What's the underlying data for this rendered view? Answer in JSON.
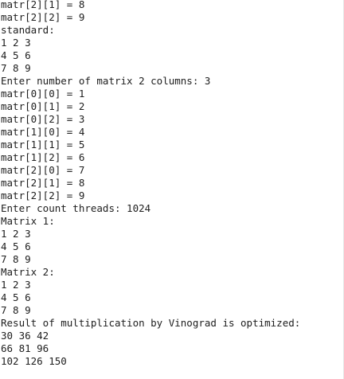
{
  "console": {
    "lines": [
      "matr[2][1] = 8",
      "matr[2][2] = 9",
      "standard:",
      "1 2 3",
      "4 5 6",
      "7 8 9",
      "Enter number of matrix 2 columns: 3",
      "matr[0][0] = 1",
      "matr[0][1] = 2",
      "matr[0][2] = 3",
      "matr[1][0] = 4",
      "matr[1][1] = 5",
      "matr[1][2] = 6",
      "matr[2][0] = 7",
      "matr[2][1] = 8",
      "matr[2][2] = 9",
      "Enter count threads: 1024",
      "Matrix 1:",
      "1 2 3",
      "4 5 6",
      "7 8 9",
      "Matrix 2:",
      "1 2 3",
      "4 5 6",
      "7 8 9",
      "Result of multiplication by Vinograd is optimized:",
      "30 36 42",
      "66 81 96",
      "102 126 150"
    ]
  }
}
